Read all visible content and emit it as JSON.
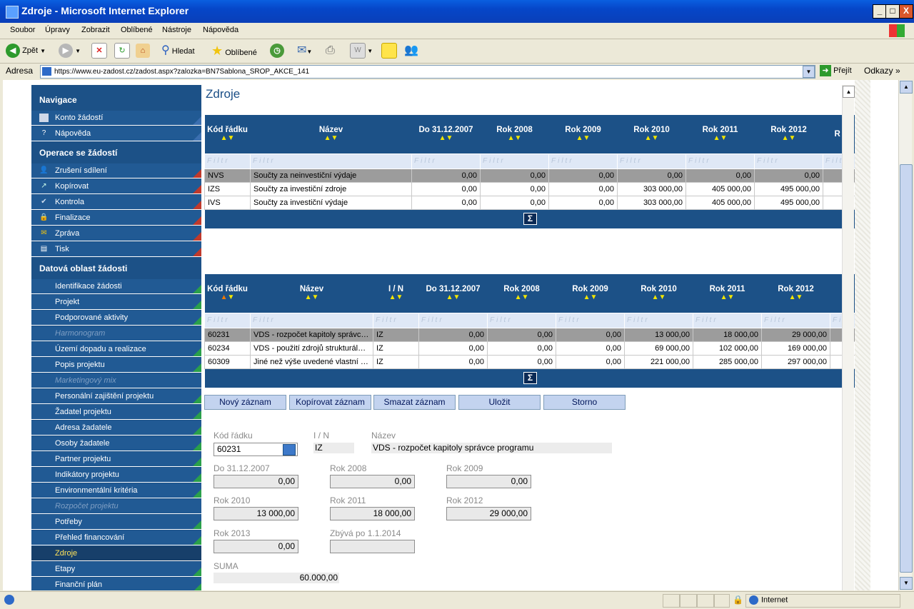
{
  "window": {
    "title": "Zdroje - Microsoft Internet Explorer",
    "min": "_",
    "max": "□",
    "close": "X"
  },
  "menu": [
    "Soubor",
    "Úpravy",
    "Zobrazit",
    "Oblíbené",
    "Nástroje",
    "Nápověda"
  ],
  "toolbar": {
    "back": "Zpět",
    "search": "Hledat",
    "favorites": "Oblíbené"
  },
  "address": {
    "label": "Adresa",
    "url": "https://www.eu-zadost.cz/zadost.aspx?zalozka=BN7Sablona_SROP_AKCE_141",
    "go": "Přejít",
    "links": "Odkazy"
  },
  "sidebar": {
    "nav_header": "Navigace",
    "nav_items": [
      "Konto žádostí",
      "Nápověda"
    ],
    "ops_header": "Operace se žádostí",
    "ops_items": [
      "Zrušení sdílení",
      "Kopírovat",
      "Kontrola",
      "Finalizace",
      "Zpráva",
      "Tisk"
    ],
    "data_header": "Datová oblast žádosti",
    "data_items": [
      "Identifikace žádosti",
      "Projekt",
      "Podporované aktivity",
      "Harmonogram",
      "Území dopadu a realizace",
      "Popis projektu",
      "Marketingový mix",
      "Personální zajištění projektu",
      "Žadatel projektu",
      "Adresa žadatele",
      "Osoby žadatele",
      "Partner projektu",
      "Indikátory projektu",
      "Environmentální kritéria",
      "Rozpočet projektu",
      "Potřeby",
      "Přehled financování",
      "Zdroje",
      "Etapy",
      "Finanční plán"
    ]
  },
  "page": {
    "title": "Zdroje"
  },
  "sort_arrows": "▲▼",
  "filter_text": "Filtr",
  "table1": {
    "headers": [
      "Kód řádku",
      "Název",
      "Do 31.12.2007",
      "Rok 2008",
      "Rok 2009",
      "Rok 2010",
      "Rok 2011",
      "Rok 2012",
      "R"
    ],
    "rows": [
      [
        "NVS",
        "Součty za neinvestiční výdaje",
        "0,00",
        "0,00",
        "0,00",
        "0,00",
        "0,00",
        "0,00",
        ""
      ],
      [
        "IZS",
        "Součty za investiční zdroje",
        "0,00",
        "0,00",
        "0,00",
        "303 000,00",
        "405 000,00",
        "495 000,00",
        ""
      ],
      [
        "IVS",
        "Součty za investiční výdaje",
        "0,00",
        "0,00",
        "0,00",
        "303 000,00",
        "405 000,00",
        "495 000,00",
        ""
      ]
    ],
    "footer": "Σ"
  },
  "table2": {
    "headers": [
      "Kód řádku",
      "Název",
      "I / N",
      "Do 31.12.2007",
      "Rok 2008",
      "Rok 2009",
      "Rok 2010",
      "Rok 2011",
      "Rok 2012"
    ],
    "rows": [
      [
        "60231",
        "VDS - rozpočet kapitoly správce programu",
        "IZ",
        "0,00",
        "0,00",
        "0,00",
        "13 000,00",
        "18 000,00",
        "29 000,00"
      ],
      [
        "60234",
        "VDS - použití zdrojů strukturálních fondů",
        "IZ",
        "0,00",
        "0,00",
        "0,00",
        "69 000,00",
        "102 000,00",
        "169 000,00"
      ],
      [
        "60309",
        "Jiné než výše uvedené vlastní zdroje",
        "IZ",
        "0,00",
        "0,00",
        "0,00",
        "221 000,00",
        "285 000,00",
        "297 000,00"
      ]
    ],
    "footer": "Σ"
  },
  "buttons": [
    "Nový záznam",
    "Kopírovat záznam",
    "Smazat záznam",
    "Uložit",
    "Storno"
  ],
  "form": {
    "kod_label": "Kód řádku",
    "kod_value": "60231",
    "in_label": "I / N",
    "in_value": "IZ",
    "nazev_label": "Název",
    "nazev_value": "VDS - rozpočet kapitoly správce programu",
    "do2007_label": "Do 31.12.2007",
    "do2007_value": "0,00",
    "r2008_label": "Rok 2008",
    "r2008_value": "0,00",
    "r2009_label": "Rok 2009",
    "r2009_value": "0,00",
    "r2010_label": "Rok 2010",
    "r2010_value": "13 000,00",
    "r2011_label": "Rok 2011",
    "r2011_value": "18 000,00",
    "r2012_label": "Rok 2012",
    "r2012_value": "29 000,00",
    "r2013_label": "Rok 2013",
    "r2013_value": "0,00",
    "zbyva_label": "Zbývá po 1.1.2014",
    "zbyva_value": "",
    "suma_label": "SUMA",
    "suma_value": "60.000,00"
  },
  "status": {
    "zone": "Internet"
  },
  "colors": {
    "header_blue": "#1c5187",
    "selected_text": "#ffe35a",
    "button_bg": "#c3d3ef"
  }
}
